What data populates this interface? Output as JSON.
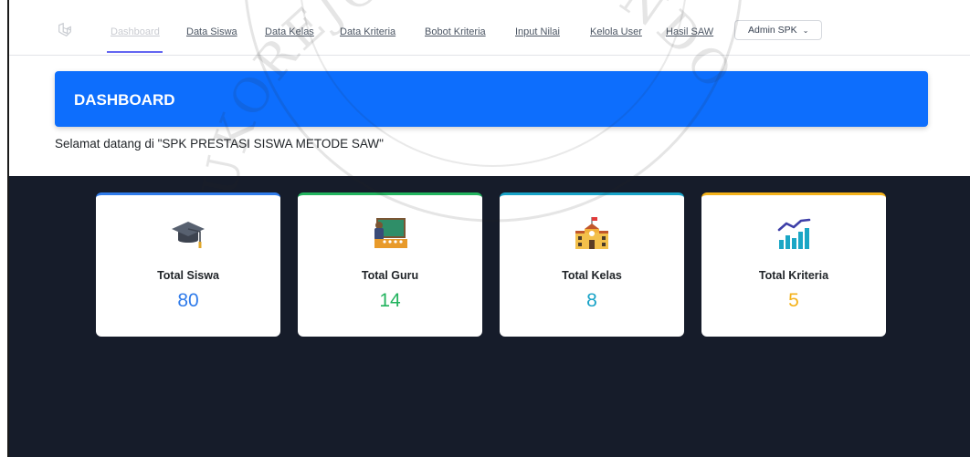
{
  "navbar": {
    "links": [
      "Dashboard",
      "Data Siswa",
      "Data Kelas",
      "Data Kriteria",
      "Bobot Kriteria",
      "Input Nilai",
      "Kelola User",
      "Hasil SAW"
    ],
    "active": "Dashboard",
    "user": "Admin SPK"
  },
  "banner": {
    "title": "DASHBOARD"
  },
  "welcome": "Selamat datang di \"SPK PRESTASI SISWA METODE SAW\"",
  "cards": [
    {
      "label": "Total Siswa",
      "value": "80",
      "icon": "graduation-cap-icon",
      "accent": "#2f7bea"
    },
    {
      "label": "Total Guru",
      "value": "14",
      "icon": "teacher-board-icon",
      "accent": "#22b35e"
    },
    {
      "label": "Total Kelas",
      "value": "8",
      "icon": "school-building-icon",
      "accent": "#17a2c7"
    },
    {
      "label": "Total Kriteria",
      "value": "5",
      "icon": "bar-chart-icon",
      "accent": "#f4b21a"
    }
  ],
  "watermark": {
    "text": "UKOREJO SITUBONDO"
  }
}
